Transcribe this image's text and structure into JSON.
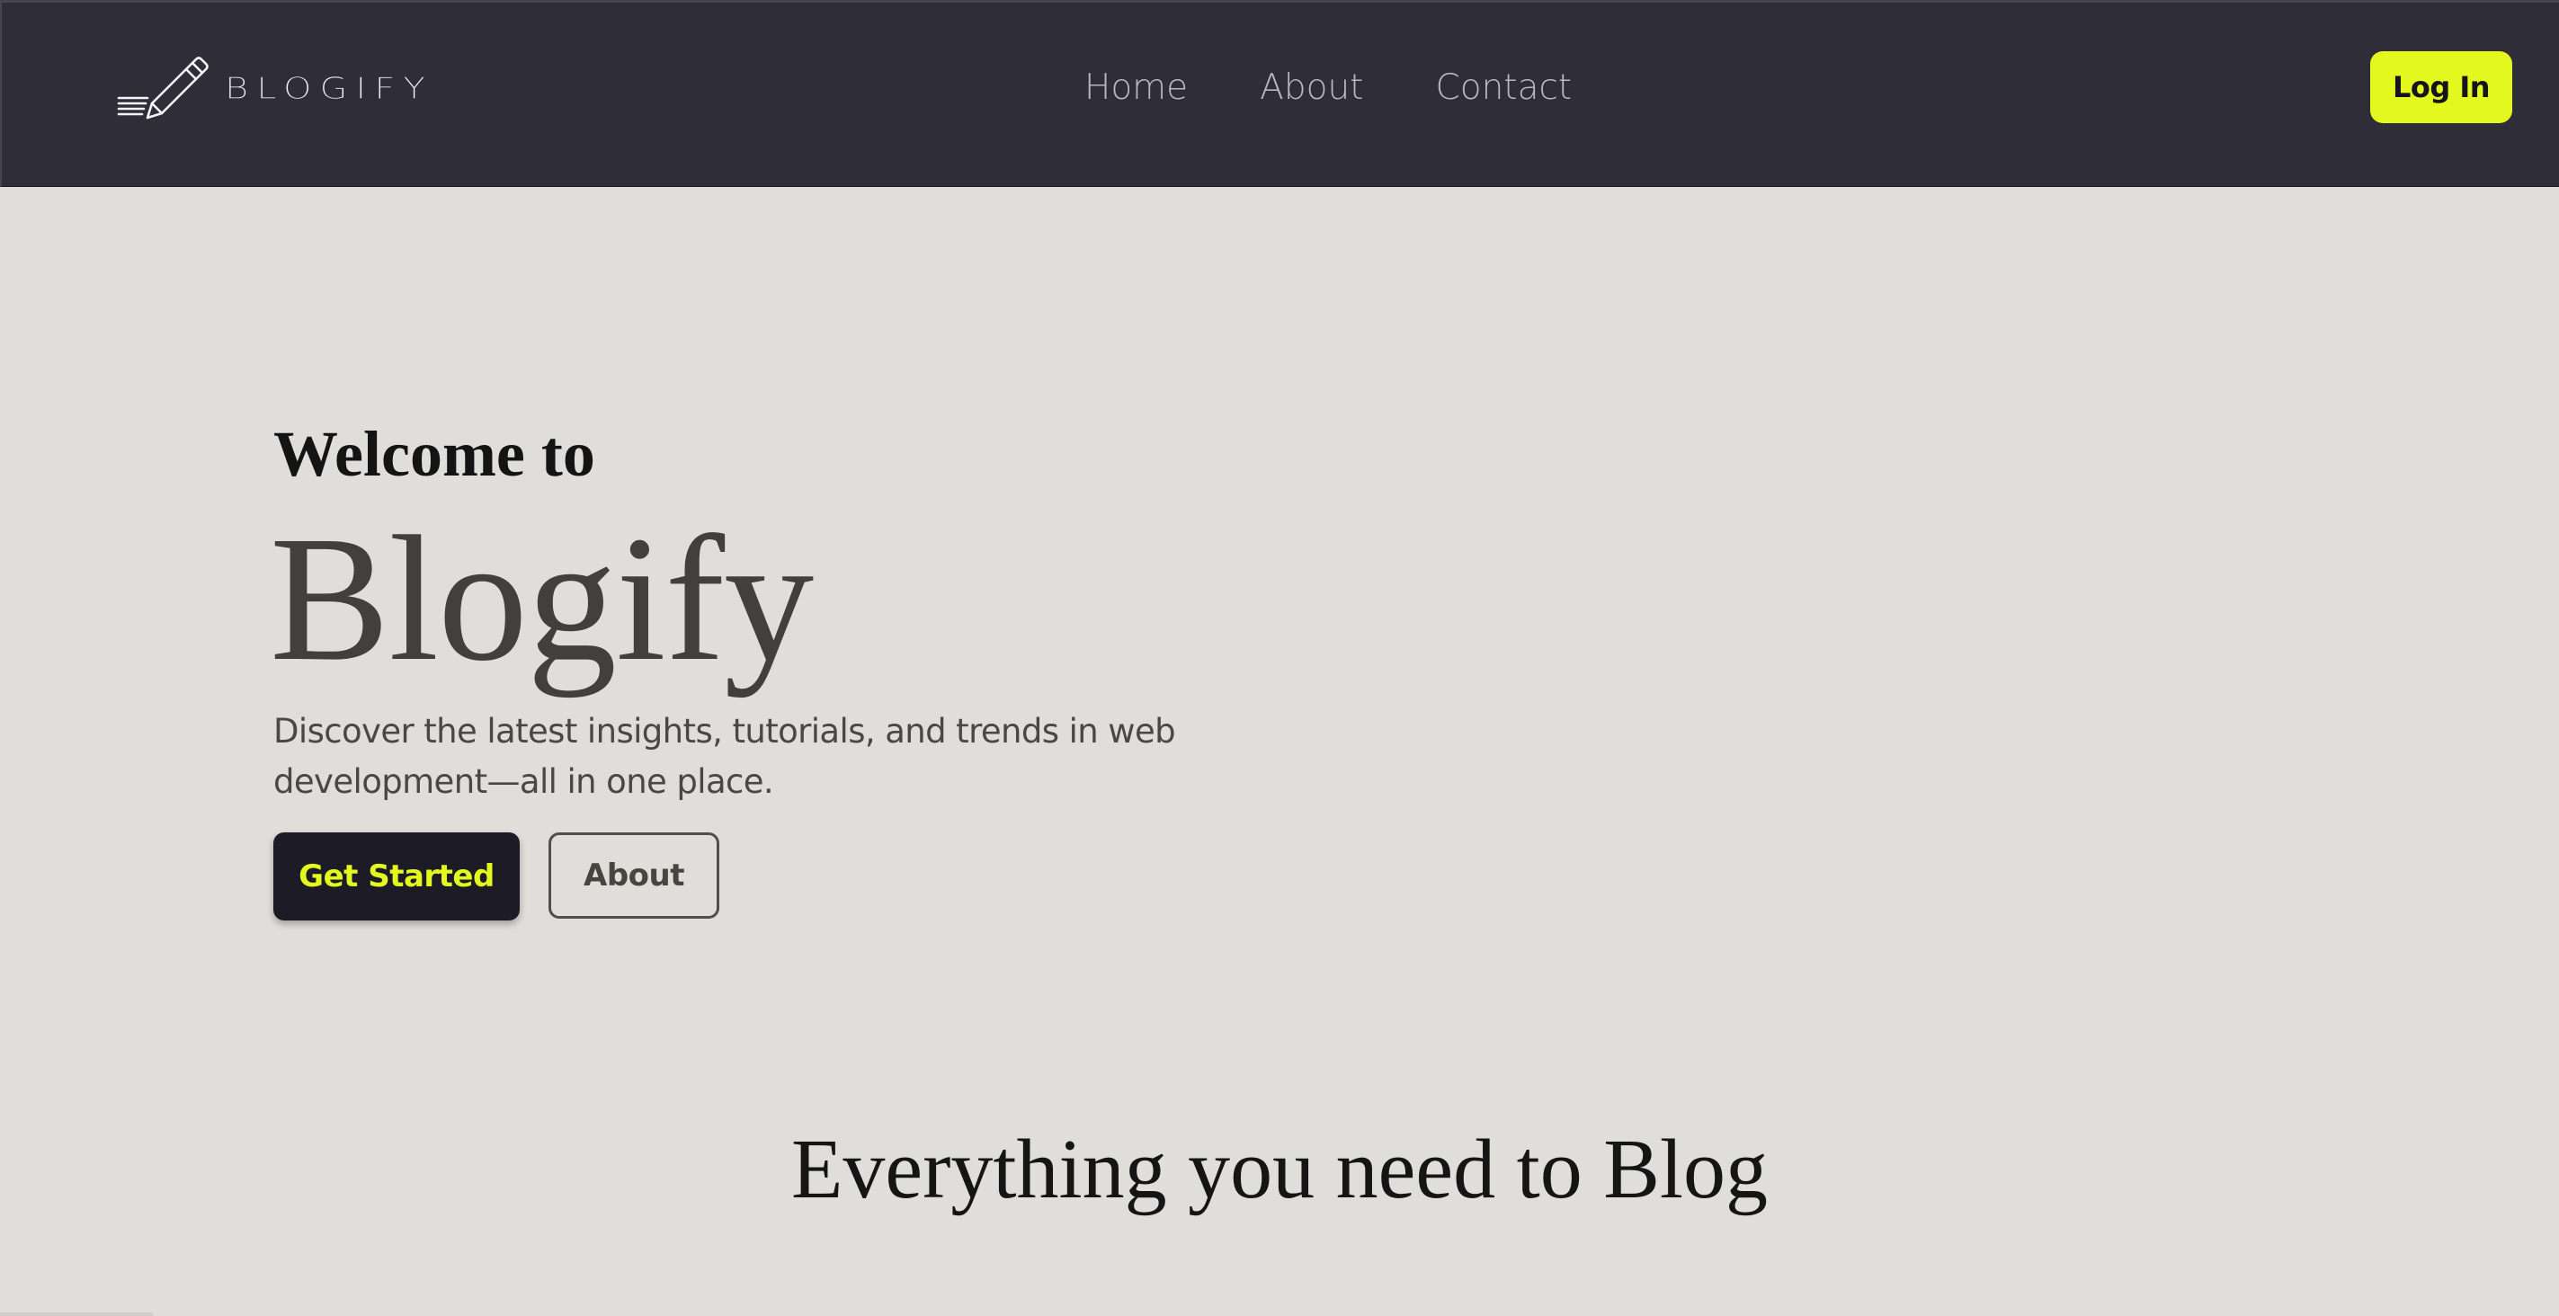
{
  "navbar": {
    "brand": "BLOGIFY",
    "brand_icon": "pencil-icon",
    "links": [
      {
        "label": "Home"
      },
      {
        "label": "About"
      },
      {
        "label": "Contact"
      }
    ],
    "login_label": "Log In"
  },
  "hero": {
    "welcome": "Welcome to",
    "title": "Blogify",
    "description": "Discover the latest insights, tutorials, and trends in web development—all in one place.",
    "primary_button": "Get Started",
    "secondary_button": "About"
  },
  "features": {
    "heading": "Everything you need to Blog"
  },
  "colors": {
    "navbar_bg": "#2f2d38",
    "page_bg": "#e0deda",
    "accent": "#e3f81f",
    "primary_button_bg": "#1d1b26",
    "nav_link": "#b9b8c2"
  }
}
